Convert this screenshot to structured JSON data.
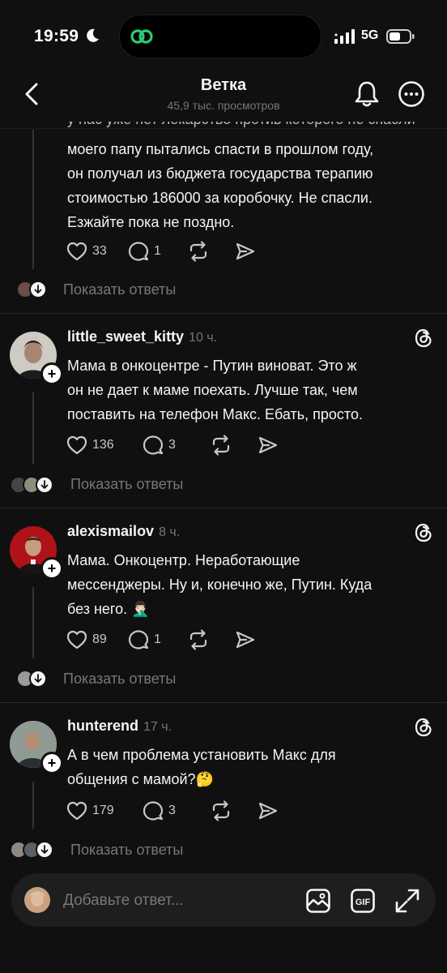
{
  "status_bar": {
    "time": "19:59",
    "network": "5G"
  },
  "header": {
    "title": "Ветка",
    "subtitle": "45,9 тыс. просмотров"
  },
  "posts": [
    {
      "text_lines": [
        "моего папу пытались спасти в прошлом году,",
        "он получал из бюджета государства терапию",
        "стоимостью 186000 за коробочку. Не спасли.",
        "Езжайте пока не поздно."
      ],
      "likes": "33",
      "replies": "1",
      "show_replies": "Показать ответы"
    },
    {
      "username": "little_sweet_kitty",
      "time": "10 ч.",
      "text_lines": [
        "Мама в онкоцентре - Путин виноват. Это ж",
        "он не дает к маме поехать. Лучше так, чем",
        "поставить на телефон Макс. Ебать, просто."
      ],
      "likes": "136",
      "replies": "3",
      "show_replies": "Показать ответы"
    },
    {
      "username": "alexismailov",
      "time": "8 ч.",
      "text_lines": [
        "Мама. Онкоцентр. Неработающие",
        "мессенджеры. Ну и, конечно же, Путин. Куда",
        "без него. 🤦🏻‍♂️"
      ],
      "likes": "89",
      "replies": "1",
      "show_replies": "Показать ответы"
    },
    {
      "username": "hunterend",
      "time": "17 ч.",
      "text_lines": [
        "А в чем проблема установить Макс для",
        "общения с мамой?🤔"
      ],
      "likes": "179",
      "replies": "3",
      "show_replies": "Показать ответы"
    }
  ],
  "composer": {
    "placeholder": "Добавьте ответ..."
  },
  "icons": {
    "back": "chevron-left-icon",
    "bell": "bell-icon",
    "more": "more-icon",
    "like": "heart-icon",
    "reply": "comment-icon",
    "repost": "repost-icon",
    "share": "send-icon",
    "threads": "threads-logo-icon",
    "image": "image-icon",
    "gif": "gif-icon",
    "expand": "expand-icon"
  },
  "colors": {
    "background": "#101010",
    "text": "#f3f5f7",
    "muted": "#777777",
    "accent_logo": "#2ecc71"
  }
}
